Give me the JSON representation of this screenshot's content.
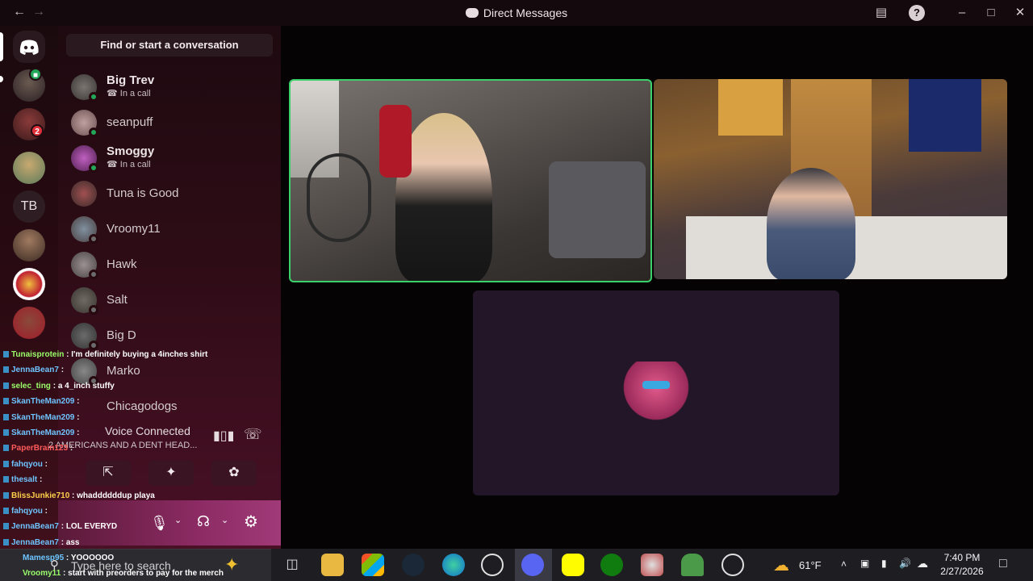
{
  "window": {
    "title": "Direct Messages",
    "back_icon": "arrow-left-icon",
    "forward_icon": "arrow-right-icon"
  },
  "dm_sidebar": {
    "search_label": "Find or start a conversation",
    "conversations": [
      {
        "name": "Big Trev",
        "sub": "In a call",
        "status": "online"
      },
      {
        "name": "seanpuff",
        "sub": "",
        "status": "online"
      },
      {
        "name": "Smoggy",
        "sub": "In a call",
        "status": "online"
      },
      {
        "name": "Tuna is Good",
        "sub": "",
        "status": "none"
      },
      {
        "name": "Vroomy11",
        "sub": "",
        "status": "offline"
      },
      {
        "name": "Hawk",
        "sub": "",
        "status": "offline"
      },
      {
        "name": "Salt",
        "sub": "",
        "status": "offline"
      },
      {
        "name": "Big D",
        "sub": "",
        "status": "offline"
      },
      {
        "name": "Marko",
        "sub": "",
        "status": "offline"
      },
      {
        "name": "Chicagodogs",
        "sub": "",
        "status": "offline"
      }
    ]
  },
  "server_rail": {
    "home_icon": "discord-logo-icon",
    "tb_label": "TB",
    "badge_count": "2"
  },
  "voice_panel": {
    "status": "Voice Connected",
    "channel": "2 AMERICANS AND A DENT HEAD..."
  },
  "chat_overlay": [
    {
      "user": "Tunaisprotein",
      "msg": "I'm definitely buying a 4inches shirt"
    },
    {
      "user": "JennaBean7",
      "msg": ""
    },
    {
      "user": "selec_ting",
      "msg": "a 4_inch stuffy"
    },
    {
      "user": "SkanTheMan209",
      "msg": ""
    },
    {
      "user": "SkanTheMan209",
      "msg": ""
    },
    {
      "user": "SkanTheMan209",
      "msg": ""
    },
    {
      "user": "PaperBrain123",
      "msg": ""
    },
    {
      "user": "fahqyou",
      "msg": ""
    },
    {
      "user": "thesalt",
      "msg": ""
    },
    {
      "user": "BlissJunkie710",
      "msg": "whaddddddup playa"
    },
    {
      "user": "fahqyou",
      "msg": ""
    },
    {
      "user": "JennaBean7",
      "msg": "LOL EVERYD"
    },
    {
      "user": "JennaBean7",
      "msg": "ass"
    },
    {
      "user": "Mamesp95",
      "msg": "YOOOOOO"
    },
    {
      "user": "Vroomy11",
      "msg": "start with preorders to pay for the merch"
    }
  ],
  "taskbar": {
    "search_placeholder": "Type here to search",
    "weather": "61°F",
    "time": "7:40 PM",
    "date": "2/27/2026"
  },
  "colors": {
    "speaking_border": "#3bd16a",
    "online": "#23a55a",
    "badge": "#e0303a",
    "chat_user": "#6ec4ff"
  }
}
